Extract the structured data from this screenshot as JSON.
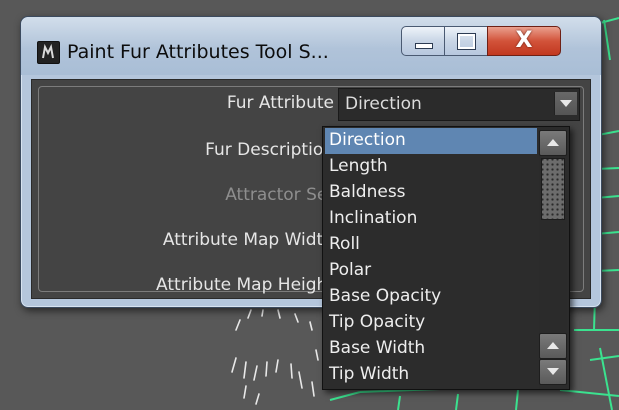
{
  "window": {
    "title": "Paint Fur Attributes Tool S..."
  },
  "icons": {
    "app": "maya-app-icon",
    "minimize": "minimize-icon",
    "maximize": "maximize-icon",
    "close": "close-icon",
    "dropdown_arrow": "chevron-down-icon",
    "scroll_up": "arrow-up-icon",
    "scroll_down": "arrow-down-icon"
  },
  "caption": {
    "close_glyph": "X"
  },
  "form": {
    "fur_attribute_label": "Fur Attribute",
    "fur_description_label": "Fur Description",
    "attractor_set_label": "Attractor Set",
    "attribute_map_width_label": "Attribute Map Width",
    "attribute_map_height_label": "Attribute Map Height",
    "fur_attribute_value": "Direction"
  },
  "dropdown": {
    "selected_index": 0,
    "options": [
      "Direction",
      "Length",
      "Baldness",
      "Inclination",
      "Roll",
      "Polar",
      "Base Opacity",
      "Tip Opacity",
      "Base Width",
      "Tip Width"
    ]
  },
  "colors": {
    "selection": "#5f86b2",
    "client_bg": "#444444",
    "viewport_wire": "#3be28f",
    "close_button": "#c83f26"
  }
}
